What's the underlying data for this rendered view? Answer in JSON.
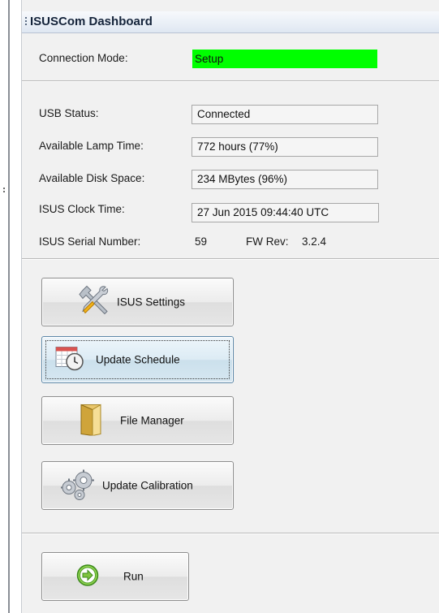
{
  "window": {
    "title": "ISUSCom Dashboard"
  },
  "connection": {
    "label": "Connection Mode:",
    "value": "Setup",
    "color": "#00ff00"
  },
  "status": {
    "usb_label": "USB Status:",
    "usb_value": "Connected",
    "lamp_label": "Available Lamp Time:",
    "lamp_value": "772 hours (77%)",
    "disk_label": "Available Disk Space:",
    "disk_value": "234 MBytes (96%)",
    "clock_label": "ISUS Clock Time:",
    "clock_value": "27 Jun 2015 09:44:40 UTC",
    "serial_label": "ISUS  Serial Number:",
    "serial_value": "59",
    "fw_label": "FW Rev:",
    "fw_value": "3.2.4"
  },
  "actions": {
    "settings_label": "ISUS Settings",
    "schedule_label": "Update Schedule",
    "files_label": "File Manager",
    "calibration_label": "Update Calibration",
    "run_label": "Run"
  },
  "icons": {
    "settings": "tools-icon",
    "schedule": "calendar-clock-icon",
    "files": "folder-icon",
    "calibration": "gears-icon",
    "run": "arrow-right-circle-icon"
  }
}
